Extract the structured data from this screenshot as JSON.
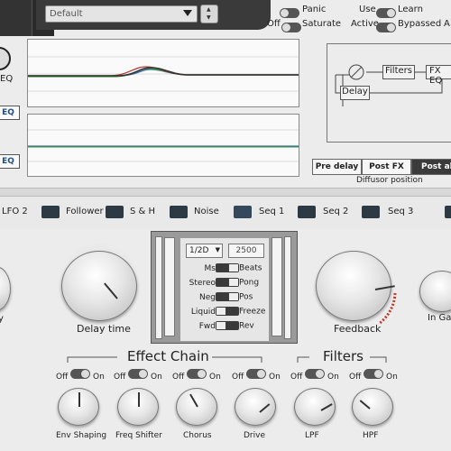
{
  "header": {
    "preset_value": "Default",
    "panic_label": "Panic",
    "off_label": "Off",
    "saturate_label": "Saturate",
    "use_label": "Use",
    "learn_label": "Learn",
    "active_label": "Active",
    "bypassed_label": "Bypassed",
    "cut_label": "A"
  },
  "eq_side": {
    "eq_top": "EQ",
    "eq_btn1": "EQ",
    "eq_btn2": "EQ"
  },
  "routing": {
    "filters_label": "Filters",
    "fxeq_label": "FX EQ",
    "delay_label": "Delay",
    "tabs": [
      "Pre delay",
      "Post FX",
      "Post al"
    ],
    "diffusor_label": "Diffusor position"
  },
  "mod_sources": [
    "LFO 2",
    "Follower",
    "S & H",
    "Noise",
    "Seq 1",
    "Seq 2",
    "Seq 3"
  ],
  "center": {
    "sync_value": "1/2D",
    "time_value": "2500",
    "switches": [
      {
        "left": "Ms",
        "right": "Beats"
      },
      {
        "left": "Stereo",
        "right": "Pong"
      },
      {
        "left": "Neg",
        "right": "Pos"
      },
      {
        "left": "Liquid",
        "right": "Freeze"
      },
      {
        "left": "Fwd",
        "right": "Rev"
      }
    ]
  },
  "knobs_main": {
    "left_cut": "y",
    "delay_time": "Delay time",
    "feedback": "Feedback",
    "in_gain": "In Gai"
  },
  "effect_chain": {
    "title": "Effect Chain",
    "items": [
      {
        "off": "Off",
        "on": "On",
        "label": "Env Shaping"
      },
      {
        "off": "Off",
        "on": "On",
        "label": "Freq Shifter"
      },
      {
        "off": "Off",
        "on": "On",
        "label": "Chorus"
      },
      {
        "off": "Off",
        "on": "On",
        "label": "Drive"
      }
    ]
  },
  "filters": {
    "title": "Filters",
    "items": [
      {
        "off": "Off",
        "on": "On",
        "label": "LPF"
      },
      {
        "off": "Off",
        "on": "On",
        "label": "HPF"
      }
    ]
  },
  "colors": {
    "accent_blue": "#1e4f8a",
    "feedback_red": "#c0392b",
    "dark": "#2a2a2a"
  }
}
